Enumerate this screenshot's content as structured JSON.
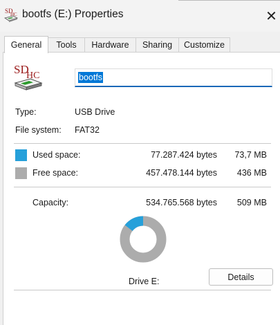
{
  "window": {
    "title": "bootfs (E:) Properties",
    "close_glyph": "✕",
    "title_icon": "sd-card-icon"
  },
  "tabs": [
    {
      "label": "General",
      "active": true
    },
    {
      "label": "Tools",
      "active": false
    },
    {
      "label": "Hardware",
      "active": false
    },
    {
      "label": "Sharing",
      "active": false
    },
    {
      "label": "Customize",
      "active": false
    }
  ],
  "drive": {
    "icon": "sdhc-card-icon",
    "icon_text_sd": "SD",
    "icon_text_hc": "HC",
    "name": "bootfs"
  },
  "info": {
    "type_label": "Type:",
    "type_value": "USB Drive",
    "fs_label": "File system:",
    "fs_value": "FAT32"
  },
  "space": {
    "used": {
      "label": "Used space:",
      "bytes": "77.287.424 bytes",
      "size": "73,7 MB",
      "color": "#26a0da"
    },
    "free": {
      "label": "Free space:",
      "bytes": "457.478.144 bytes",
      "size": "436 MB",
      "color": "#acacac"
    },
    "capacity": {
      "label": "Capacity:",
      "bytes": "534.765.568 bytes",
      "size": "509 MB"
    },
    "used_fraction": 0.1445
  },
  "drive_label": "Drive E:",
  "details_button": "Details"
}
